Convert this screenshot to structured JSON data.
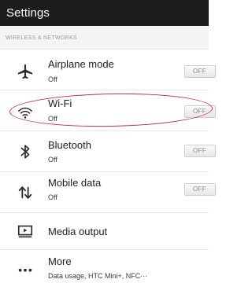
{
  "header": {
    "title": "Settings"
  },
  "section": {
    "title": "WIRELESS & NETWORKS"
  },
  "rows": {
    "airplane": {
      "label": "Airplane mode",
      "sub": "Off",
      "toggle": "OFF",
      "icon": "airplane-icon"
    },
    "wifi": {
      "label": "Wi-Fi",
      "sub": "Off",
      "toggle": "OFF",
      "icon": "wifi-icon"
    },
    "bluetooth": {
      "label": "Bluetooth",
      "sub": "Off",
      "toggle": "OFF",
      "icon": "bluetooth-icon"
    },
    "mobile_data": {
      "label": "Mobile data",
      "sub": "Off",
      "toggle": "OFF",
      "icon": "mobile-data-icon"
    },
    "media_output": {
      "label": "Media output",
      "icon": "media-output-icon"
    },
    "more": {
      "label": "More",
      "sub": "Data usage, HTC Mini+, NFC···",
      "icon": "more-icon"
    }
  },
  "colors": {
    "topbar": "#1c1c1c",
    "annotation": "#c0313d"
  }
}
